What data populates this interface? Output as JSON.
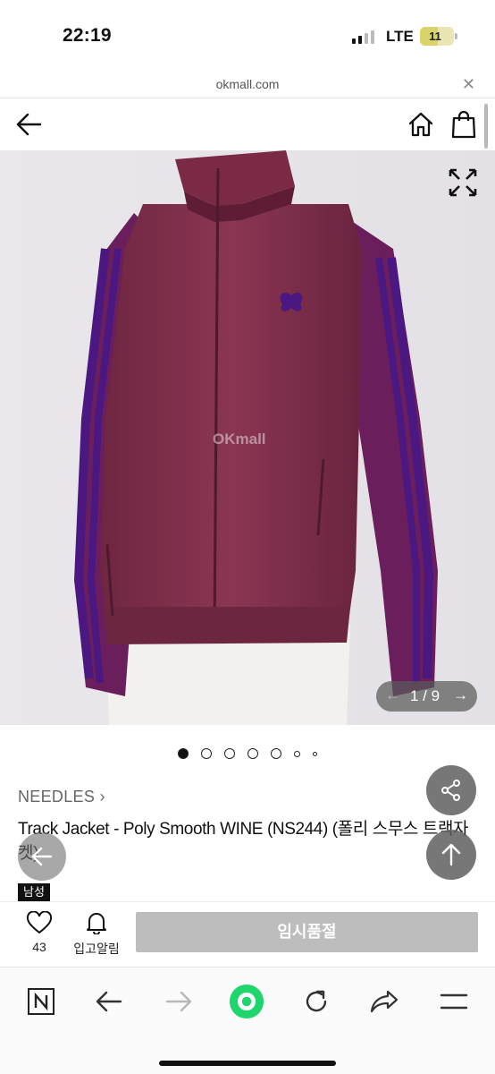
{
  "status_bar": {
    "time": "22:19",
    "network": "LTE",
    "battery": "11"
  },
  "browser": {
    "url": "okmall.com",
    "close_icon": "close-icon"
  },
  "header": {
    "back_icon": "arrow-left-icon",
    "home_icon": "home-icon",
    "cart_icon": "shopping-bag-icon"
  },
  "gallery": {
    "watermark": "OKmall",
    "counter": "1 / 9",
    "expand_icon": "expand-icon",
    "dot_count": 7,
    "active_dot": 0
  },
  "product": {
    "brand": "NEEDLES",
    "brand_chevron": "›",
    "title": "Track Jacket - Poly Smooth WINE (NS244) (폴리 스무스 트랙자켓)",
    "gender_badge": "남성"
  },
  "actions": {
    "like_count": "43",
    "alert_label": "입고알림",
    "soldout_label": "임시품절"
  },
  "colors": {
    "jacket": "#7a2a45",
    "stripe": "#5a1f86",
    "soldout": "#bdbdbd",
    "home_green": "#1ed66b"
  },
  "toolbar": {
    "items": [
      "naver-n-icon",
      "back-icon",
      "forward-icon",
      "home-circle-icon",
      "reload-icon",
      "share-icon",
      "menu-icon"
    ]
  }
}
